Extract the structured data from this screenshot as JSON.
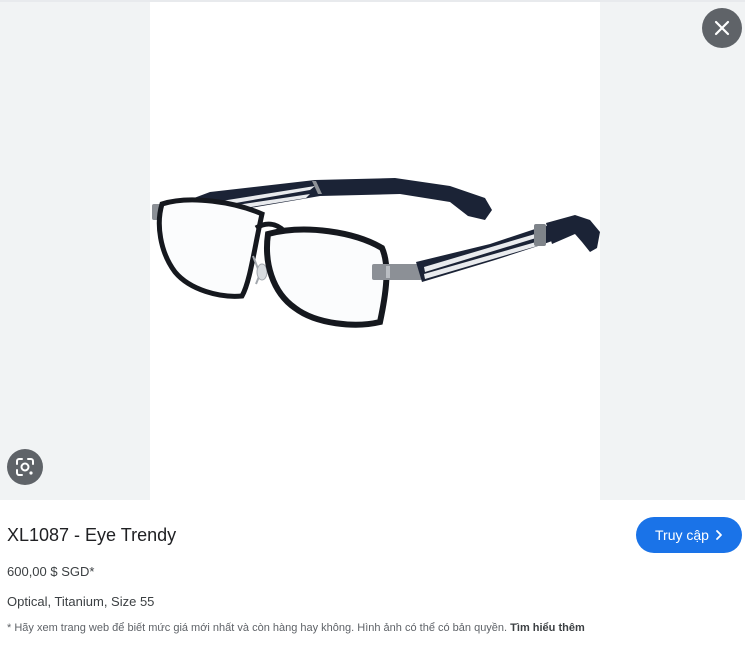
{
  "product": {
    "title": "XL1087 - Eye Trendy",
    "price": "600,00 $ SGD*",
    "attributes": "Optical, Titanium, Size 55",
    "image_subject": "glasses-image"
  },
  "actions": {
    "visit_label": "Truy cập",
    "visit_icon": "chevron-right-icon",
    "close_icon": "close-icon",
    "lens_icon": "google-lens-icon"
  },
  "disclaimer": {
    "text": "* Hãy xem trang web để biết mức giá mới nhất và còn hàng hay không. Hình ảnh có thể có bản quyền.",
    "link": "Tìm hiểu thêm"
  },
  "colors": {
    "primary_button": "#1a73e8",
    "overlay_button": "#5f6368",
    "panel_background": "#f1f3f4"
  }
}
